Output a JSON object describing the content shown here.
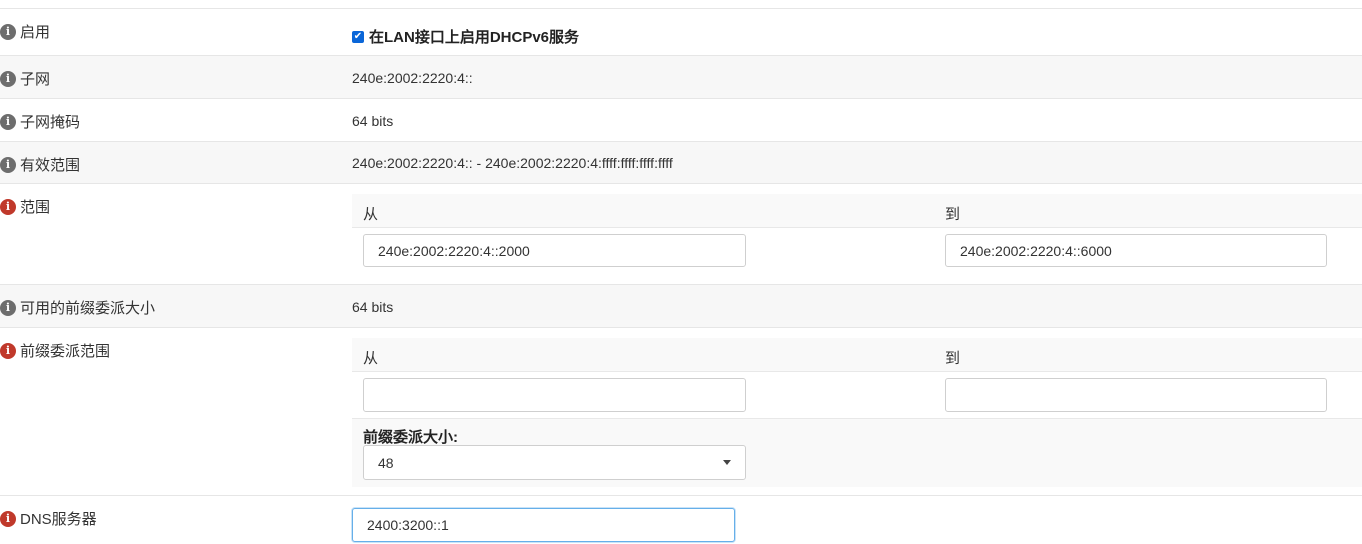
{
  "enable": {
    "label": "启用",
    "checkbox_label": "在LAN接口上启用DHCPv6服务"
  },
  "subnet": {
    "label": "子网",
    "value": "240e:2002:2220:4::"
  },
  "subnet_mask": {
    "label": "子网掩码",
    "value": "64 bits"
  },
  "valid_range": {
    "label": "有效范围",
    "value": "240e:2002:2220:4:: - 240e:2002:2220:4:ffff:ffff:ffff:ffff"
  },
  "range": {
    "label": "范围",
    "from_header": "从",
    "to_header": "到",
    "from_value": "240e:2002:2220:4::2000",
    "to_value": "240e:2002:2220:4::6000"
  },
  "prefix_size_available": {
    "label": "可用的前缀委派大小",
    "value": "64 bits"
  },
  "prefix_range": {
    "label": "前缀委派范围",
    "from_header": "从",
    "to_header": "到",
    "from_value": "",
    "to_value": "",
    "size_label": "前缀委派大小:",
    "size_value": "48"
  },
  "dns": {
    "label": "DNS服务器",
    "value": "2400:3200::1"
  },
  "colors": {
    "info_gray": "#6d6d6d",
    "info_red": "#c0392b",
    "checkbox": "#0a66d8",
    "focus": "#66afe9"
  }
}
